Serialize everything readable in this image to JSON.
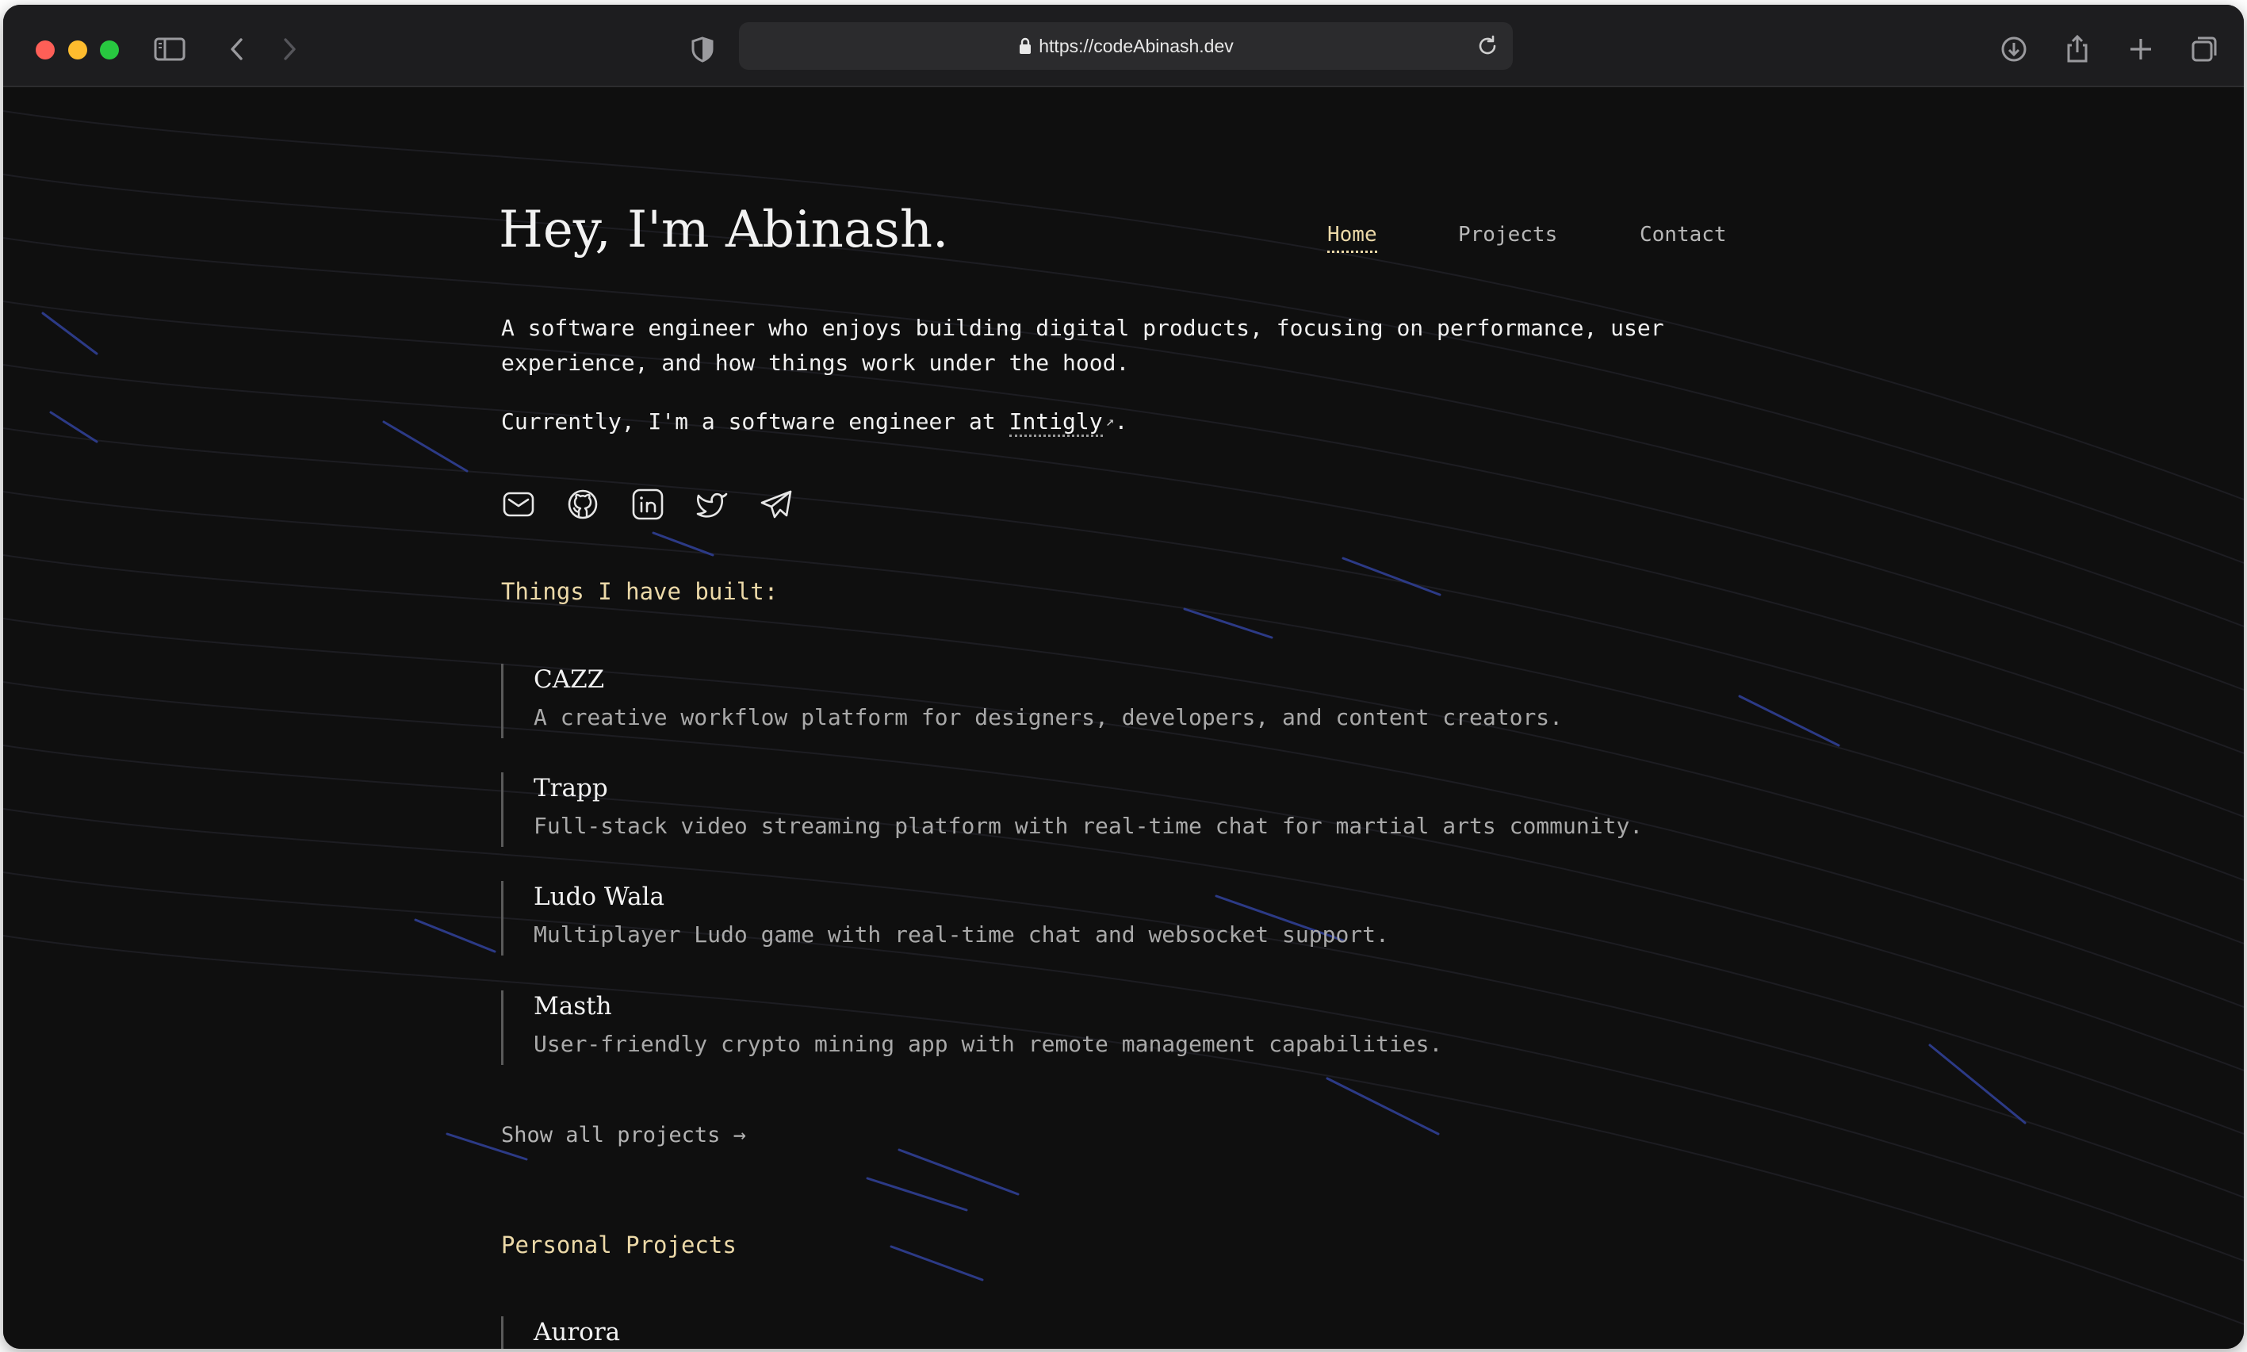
{
  "browser": {
    "url": "https://codeAbinash.dev",
    "icons": [
      "sidebar-icon",
      "back-icon",
      "forward-icon",
      "shield-icon",
      "lock-icon",
      "reload-icon",
      "download-icon",
      "share-icon",
      "new-tab-icon",
      "tab-overview-icon"
    ]
  },
  "header": {
    "title": "Hey, I'm Abinash.",
    "nav": [
      {
        "label": "Home",
        "active": true
      },
      {
        "label": "Projects",
        "active": false
      },
      {
        "label": "Contact",
        "active": false
      }
    ]
  },
  "intro": {
    "text": "A software engineer who enjoys building digital products, focusing on performance, user experience, and how things work under the hood.",
    "current_prefix": "Currently, I'm a software engineer at",
    "company": "Intigly",
    "current_suffix": "."
  },
  "socials": [
    "mail-icon",
    "github-icon",
    "linkedin-icon",
    "twitter-icon",
    "telegram-icon"
  ],
  "built": {
    "title": "Things I have built:",
    "projects": [
      {
        "name": "CAZZ",
        "description": "A creative workflow platform for designers, developers, and content creators."
      },
      {
        "name": "Trapp",
        "description": "Full-stack video streaming platform with real-time chat for martial arts community."
      },
      {
        "name": "Ludo Wala",
        "description": "Multiplayer Ludo game with real-time chat and websocket support."
      },
      {
        "name": "Masth",
        "description": "User-friendly crypto mining app with remote management capabilities."
      }
    ],
    "show_all": "Show all projects →"
  },
  "personal": {
    "title": "Personal Projects",
    "projects": [
      {
        "name": "Aurora"
      }
    ]
  },
  "colors": {
    "background": "#0f0f0f",
    "accent": "#ecd9a8",
    "text": "#f0f0f0",
    "muted": "#a9a9a9"
  }
}
